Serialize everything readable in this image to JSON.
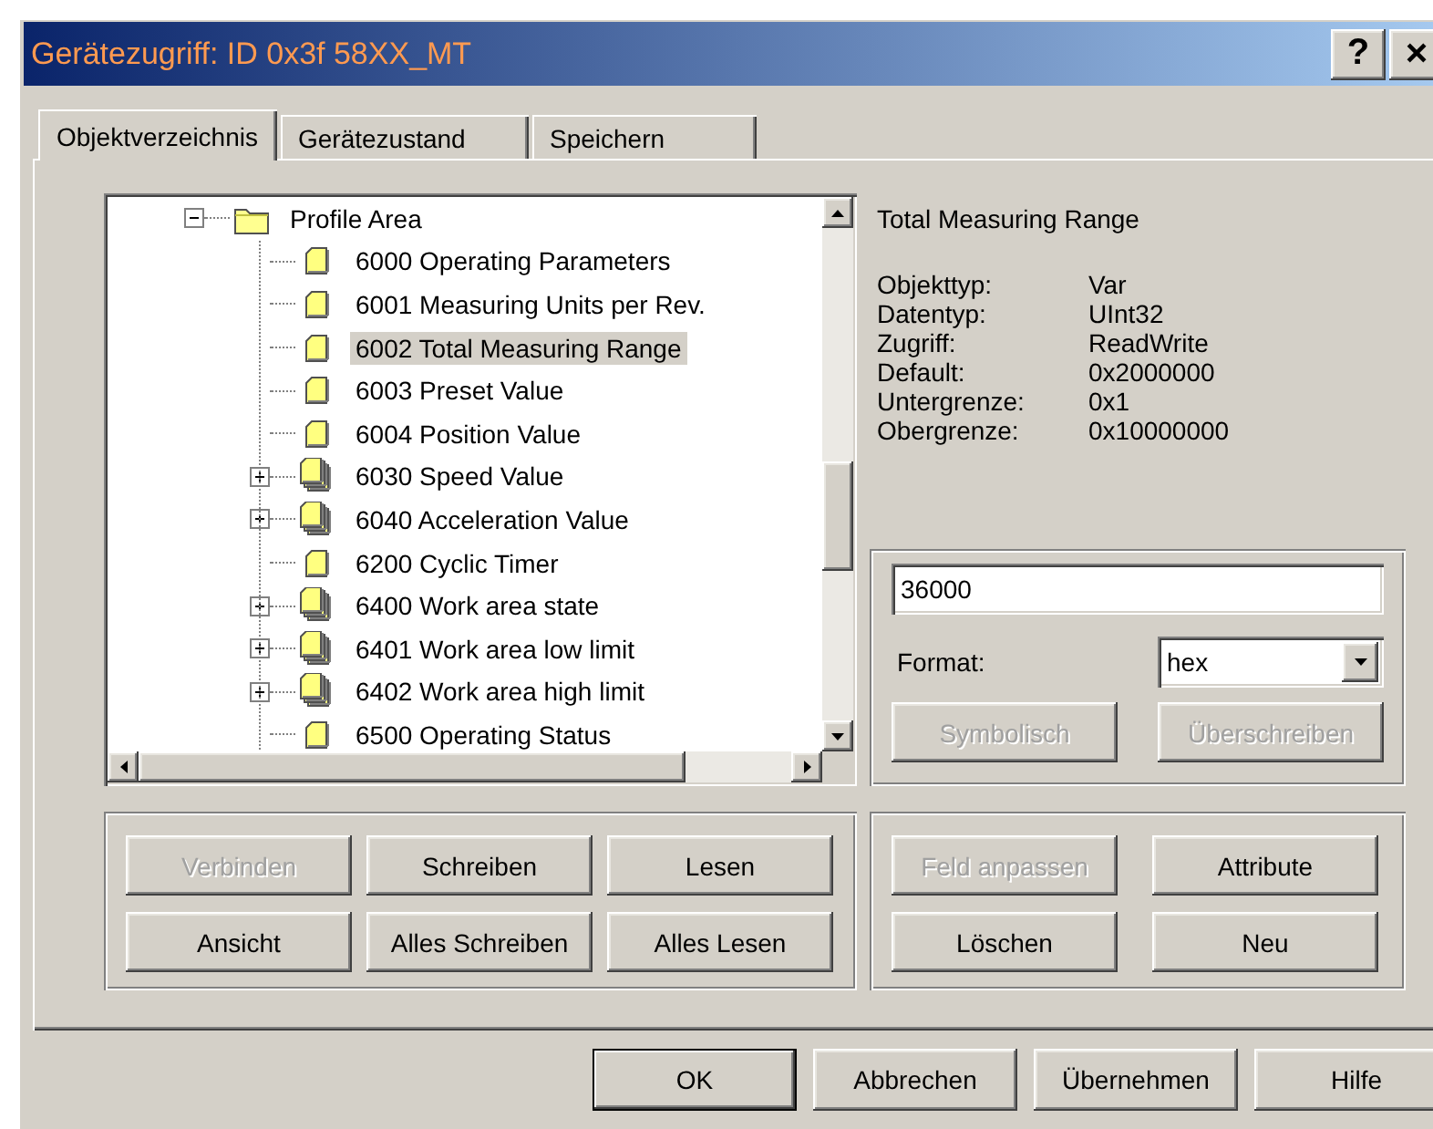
{
  "window": {
    "title": "Gerätezugriff: ID 0x3f 58XX_MT",
    "title_buttons": [
      {
        "kind": "help",
        "label": "?"
      },
      {
        "kind": "close",
        "label": "×"
      }
    ]
  },
  "tabs": [
    {
      "label": "Objektverzeichnis",
      "selected": true
    },
    {
      "label": "Gerätezustand",
      "selected": false
    },
    {
      "label": "Speichern",
      "selected": false
    }
  ],
  "tree": {
    "items": [
      {
        "label": "Profile Area",
        "kind": "folder",
        "expanded": true,
        "selected": false,
        "children": [
          {
            "label": "6000 Operating Parameters",
            "kind": "object",
            "selected": false
          },
          {
            "label": "6001 Measuring Units per Rev.",
            "kind": "object",
            "selected": false
          },
          {
            "label": "6002 Total Measuring Range",
            "kind": "object",
            "selected": true
          },
          {
            "label": "6003 Preset Value",
            "kind": "object",
            "selected": false
          },
          {
            "label": "6004 Position Value",
            "kind": "object",
            "selected": false
          },
          {
            "label": "6030 Speed Value",
            "kind": "group",
            "expanded": false,
            "selected": false
          },
          {
            "label": "6040 Acceleration Value",
            "kind": "group",
            "expanded": false,
            "selected": false
          },
          {
            "label": "6200 Cyclic Timer",
            "kind": "object",
            "selected": false
          },
          {
            "label": "6400 Work area state",
            "kind": "group",
            "expanded": false,
            "selected": false
          },
          {
            "label": "6401 Work area low limit",
            "kind": "group",
            "expanded": false,
            "selected": false
          },
          {
            "label": "6402 Work area high limit",
            "kind": "group",
            "expanded": false,
            "selected": false
          },
          {
            "label": "6500 Operating Status",
            "kind": "object",
            "selected": false
          }
        ]
      }
    ]
  },
  "details": {
    "title": "Total Measuring Range",
    "properties": [
      {
        "label": "Objekttyp:",
        "value": "Var"
      },
      {
        "label": "Datentyp:",
        "value": "UInt32"
      },
      {
        "label": "Zugriff:",
        "value": "ReadWrite"
      },
      {
        "label": "Default:",
        "value": "0x2000000"
      },
      {
        "label": "Untergrenze:",
        "value": "0x1"
      },
      {
        "label": "Obergrenze:",
        "value": "0x10000000"
      }
    ]
  },
  "value_field": {
    "value": "36000"
  },
  "format": {
    "label": "Format:",
    "value": "hex"
  },
  "value_buttons": [
    {
      "label": "Symbolisch",
      "disabled": true
    },
    {
      "label": "Überschreiben",
      "disabled": true
    }
  ],
  "object_buttons": [
    {
      "label": "Verbinden",
      "disabled": true
    },
    {
      "label": "Schreiben",
      "disabled": false
    },
    {
      "label": "Lesen",
      "disabled": false
    },
    {
      "label": "Ansicht",
      "disabled": false
    },
    {
      "label": "Alles Schreiben",
      "disabled": false
    },
    {
      "label": "Alles Lesen",
      "disabled": false
    }
  ],
  "entry_buttons": [
    {
      "label": "Feld anpassen",
      "disabled": true
    },
    {
      "label": "Attribute",
      "disabled": false
    },
    {
      "label": "Löschen",
      "disabled": false
    },
    {
      "label": "Neu",
      "disabled": false
    }
  ],
  "dialog_buttons": [
    {
      "label": "OK",
      "default": true,
      "disabled": false
    },
    {
      "label": "Abbrechen",
      "default": false,
      "disabled": false
    },
    {
      "label": "Übernehmen",
      "default": false,
      "disabled": false
    },
    {
      "label": "Hilfe",
      "default": false,
      "disabled": false
    }
  ]
}
